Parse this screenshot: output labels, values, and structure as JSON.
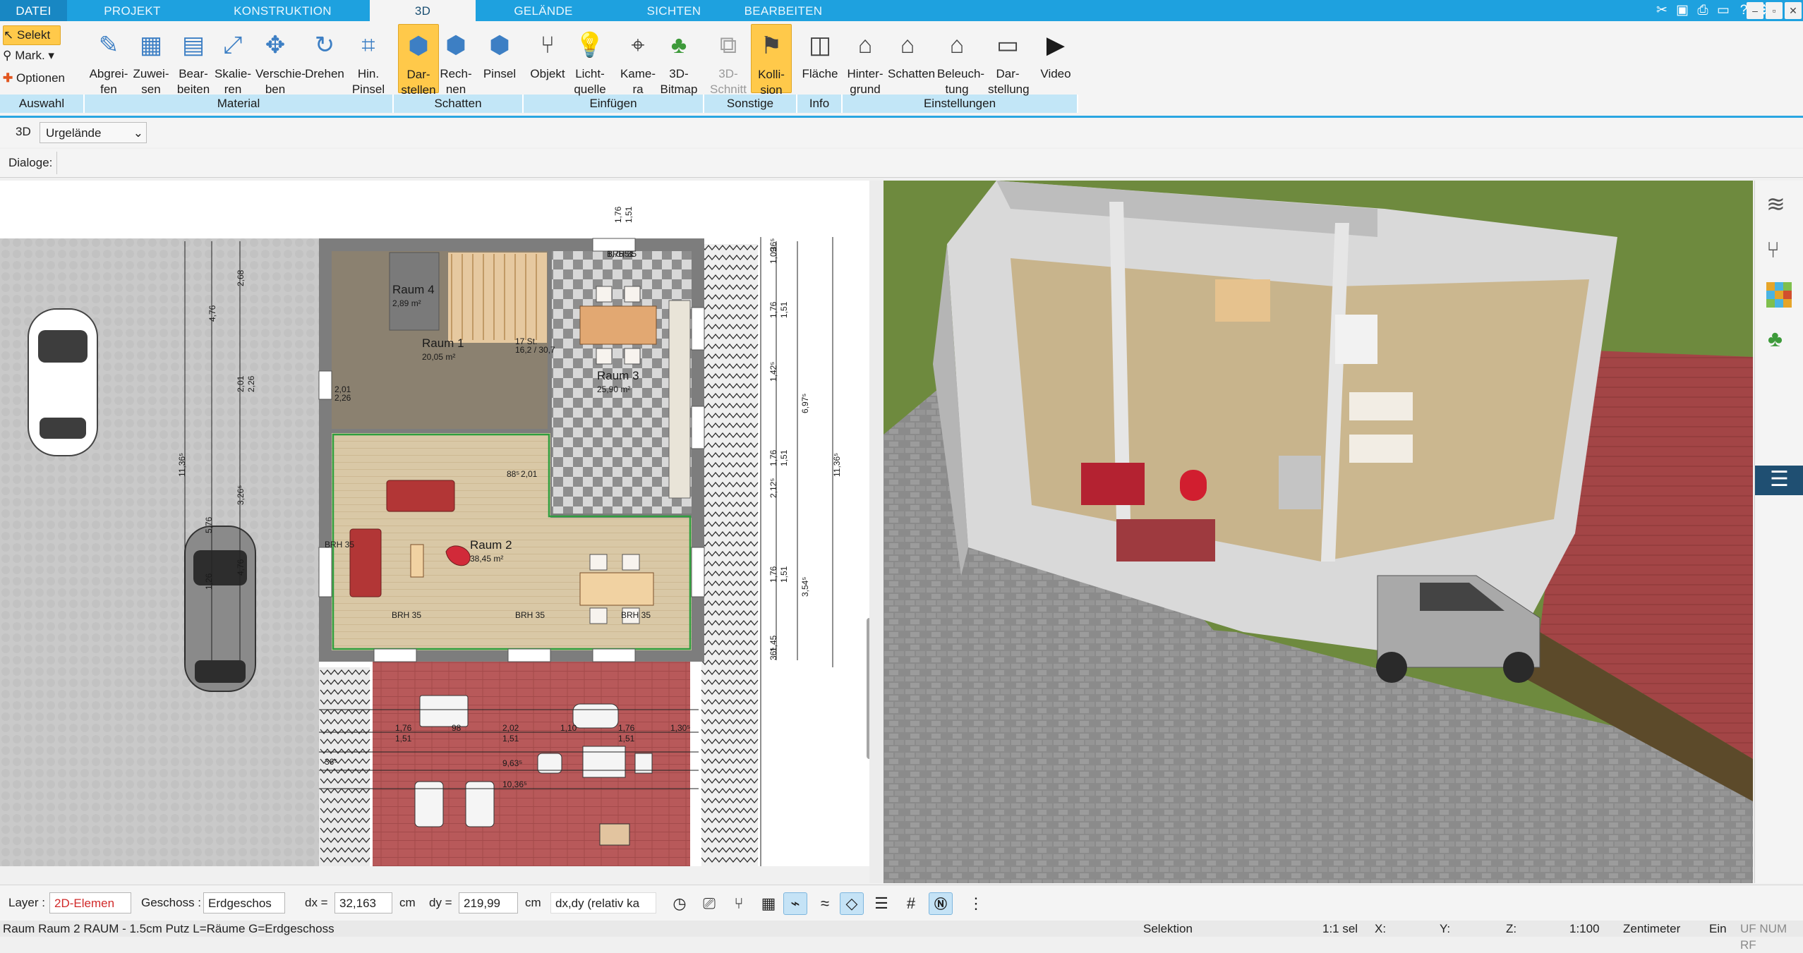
{
  "menubar": {
    "tabs": [
      {
        "label": "DATEI",
        "active": false
      },
      {
        "label": "PROJEKT",
        "active": false
      },
      {
        "label": "KONSTRUKTION",
        "active": false
      },
      {
        "label": "3D",
        "active": true
      },
      {
        "label": "GELÄNDE",
        "active": false
      },
      {
        "label": "SICHTEN",
        "active": false
      },
      {
        "label": "BEARBEITEN",
        "active": false
      }
    ],
    "window_controls": [
      "minimize",
      "restore",
      "close"
    ]
  },
  "ribbon": {
    "auswahl": {
      "selekt": "Selekt",
      "mark": "Mark.",
      "optionen": "Optionen",
      "group": "Auswahl"
    },
    "material": {
      "buttons": [
        "Abgrei-\nfen",
        "Zuwei-\nsen",
        "Bear-\nbeiten",
        "Skalie-\nren",
        "Verschie-\nben",
        "Drehen",
        "Hin.\nPinsel"
      ],
      "group": "Material"
    },
    "schatten": {
      "buttons": [
        "Dar-\nstellen",
        "Rech-\nnen",
        "Pinsel"
      ],
      "group": "Schatten"
    },
    "einfuegen": {
      "buttons": [
        "Objekt",
        "Licht-\nquelle",
        "Kame-\nra",
        "3D-\nBitmap"
      ],
      "group": "Einfügen"
    },
    "sonstige": {
      "buttons": [
        "3D-\nSchnitt",
        "Kolli-\nsion"
      ],
      "group": "Sonstige"
    },
    "info": {
      "buttons": [
        "Fläche"
      ],
      "group": "Info"
    },
    "einstellungen": {
      "buttons": [
        "Hinter-\ngrund",
        "Schatten",
        "Beleuch-\ntung",
        "Dar-\nstellung",
        "Video"
      ],
      "group": "Einstellungen"
    }
  },
  "toolbar2": {
    "mode": "3D",
    "terrain_select": "Urgelände",
    "dialoge_label": "Dialoge:"
  },
  "plan": {
    "rooms": [
      {
        "name": "Raum 4",
        "area": "2,89 m²"
      },
      {
        "name": "Raum 1",
        "area": "20,05 m²"
      },
      {
        "name": "Raum 3",
        "area": "25,90 m²"
      },
      {
        "name": "Raum 2",
        "area": "38,45 m²"
      }
    ],
    "dimensions_top": [
      "1,76",
      "1,51"
    ],
    "dimensions_left": [
      "4,76",
      "2,68",
      "2,01",
      "2,26",
      "11,36⁵",
      "3,26⁵",
      "1,26",
      "5,76",
      "4,76"
    ],
    "dimensions_right": [
      "1,09",
      "1,76",
      "1,51",
      "1,42⁵",
      "6,97⁵",
      "1,76",
      "1,51",
      "2,12⁵",
      "1,76",
      "1,51",
      "3,54⁵",
      "1,45",
      "11,36⁵",
      "36⁵",
      "36⁵"
    ],
    "dimensions_bottom": [
      "1,76",
      "1,51",
      "2,02",
      "1,51",
      "1,10",
      "1,76",
      "1,51",
      "1,30⁵",
      "9,63⁵",
      "10,36⁵",
      "98",
      "36⁵"
    ],
    "small_labels": [
      "BRH 35",
      "BRH 35",
      "BRH 35",
      "BRH 35",
      "BRH 35",
      "2,01",
      "2,26",
      "88⁵",
      "2,01",
      "17 St.",
      "16,2 / 30,7",
      "1,76",
      "1,51"
    ]
  },
  "view3d": {
    "description_free": true
  },
  "rightbar": {
    "icons": [
      "layers-icon",
      "chair-icon",
      "palette-icon",
      "tree-icon",
      "menu-icon"
    ]
  },
  "statusbar": {
    "layer_label": "Layer :",
    "layer_value": "2D-Elemen",
    "geschoss_label": "Geschoss :",
    "geschoss_value": "Erdgeschos",
    "dx_label": "dx =",
    "dx_value": "32,163",
    "dx_unit": "cm",
    "dy_label": "dy =",
    "dy_value": "219,99",
    "dy_unit": "cm",
    "rel_select": "dx,dy (relativ ka",
    "info_text": "Raum Raum 2 RAUM - 1.5cm Putz L=Räume G=Erdgeschoss",
    "selektion": "Selektion",
    "sel_count": "1:1 sel",
    "x_label": "X:",
    "y_label": "Y:",
    "z_label": "Z:",
    "scale": "1:100",
    "unit": "Zentimeter",
    "ein": "Ein",
    "flags": "UF NUM RF"
  },
  "colors": {
    "accent": "#1ea1df",
    "ribbon_group": "#c2e6f7",
    "selected_button": "#ffc94a",
    "terrace": "#a9494a",
    "wall": "#7d7d7d"
  }
}
